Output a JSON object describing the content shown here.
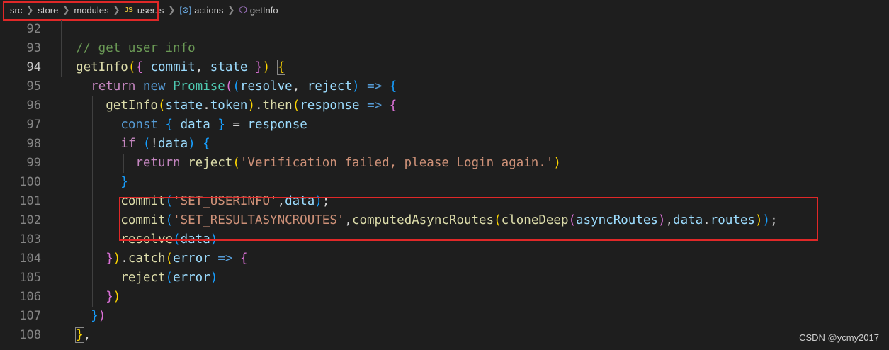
{
  "breadcrumb": {
    "items": [
      "src",
      "store",
      "modules",
      "user.js",
      "actions",
      "getInfo"
    ],
    "file_badge": "JS",
    "symbol_icon": "[⊘]",
    "method_icon": "⬡"
  },
  "lines": {
    "n92": "92",
    "n93": "93",
    "n94": "94",
    "n95": "95",
    "n96": "96",
    "n97": "97",
    "n98": "98",
    "n99": "99",
    "n100": "100",
    "n101": "101",
    "n102": "102",
    "n103": "103",
    "n104": "104",
    "n105": "105",
    "n106": "106",
    "n107": "107",
    "n108": "108"
  },
  "code": {
    "l91": "},",
    "l93_comment": "// get user info",
    "l94": {
      "fn": "getInfo",
      "p1": "commit",
      "p2": "state"
    },
    "l95": {
      "kw1": "return",
      "kw2": "new",
      "cls": "Promise",
      "a1": "resolve",
      "a2": "reject",
      "arrow": "=>"
    },
    "l96": {
      "fn": "getInfo",
      "obj": "state",
      "prop": "token",
      "then": "then",
      "arg": "response",
      "arrow": "=>"
    },
    "l97": {
      "kw": "const",
      "v": "data",
      "rhs": "response"
    },
    "l98": {
      "kw": "if",
      "v": "data"
    },
    "l99": {
      "kw": "return",
      "fn": "reject",
      "str": "'Verification failed, please Login again.'"
    },
    "l101": {
      "fn": "commit",
      "str": "'SET_USERINFO'",
      "v": "data"
    },
    "l102": {
      "fn": "commit",
      "str": "'SET_RESULTASYNCROUTES'",
      "fn2": "computedAsyncRoutes",
      "fn3": "cloneDeep",
      "v1": "asyncRoutes",
      "v2": "data",
      "v3": "routes"
    },
    "l103": {
      "fn": "resolve",
      "v": "data"
    },
    "l104": {
      "fn": "catch",
      "v": "error",
      "arrow": "=>"
    },
    "l105": {
      "fn": "reject",
      "v": "error"
    }
  },
  "watermark": "CSDN @ycmy2017",
  "colors": {
    "highlight_box": "#e02828",
    "background": "#1e1e1e"
  }
}
